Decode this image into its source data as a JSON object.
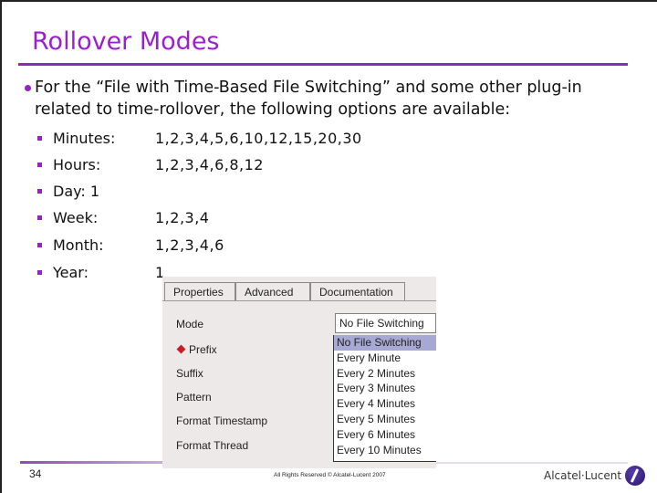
{
  "slide": {
    "title": "Rollover Modes",
    "intro": "For the “File with Time-Based File Switching” and some other plug-in related to time-rollover, the following options are available:",
    "options": [
      {
        "label": "Minutes:",
        "values": "1,2,3,4,5,6,10,12,15,20,30"
      },
      {
        "label": "Hours:",
        "values": "1,2,3,4,6,8,12"
      },
      {
        "label": "Day: 1",
        "values": ""
      },
      {
        "label": "Week:",
        "values": "1,2,3,4"
      },
      {
        "label": "Month:",
        "values": "1,2,3,4,6"
      },
      {
        "label": "Year:",
        "values": "1"
      }
    ],
    "page_number": "34",
    "copyright": "All Rights Reserved © Alcatel-Lucent 2007",
    "brand": "Alcatel·Lucent"
  },
  "dialog": {
    "tabs": [
      "Properties",
      "Advanced",
      "Documentation"
    ],
    "active_tab": "Properties",
    "fields": [
      "Mode",
      "Prefix",
      "Suffix",
      "Pattern",
      "Format Timestamp",
      "Format Thread"
    ],
    "mode_value": "No File Switching",
    "dropdown_options": [
      "No File Switching",
      "Every Minute",
      "Every 2 Minutes",
      "Every 3 Minutes",
      "Every 4 Minutes",
      "Every 5 Minutes",
      "Every 6 Minutes",
      "Every 10 Minutes"
    ],
    "selected_option": "No File Switching",
    "colors": {
      "required_marker": "#c81d25",
      "selection": "#a8a8d4"
    }
  },
  "colors": {
    "accent": "#9b1fcf"
  }
}
